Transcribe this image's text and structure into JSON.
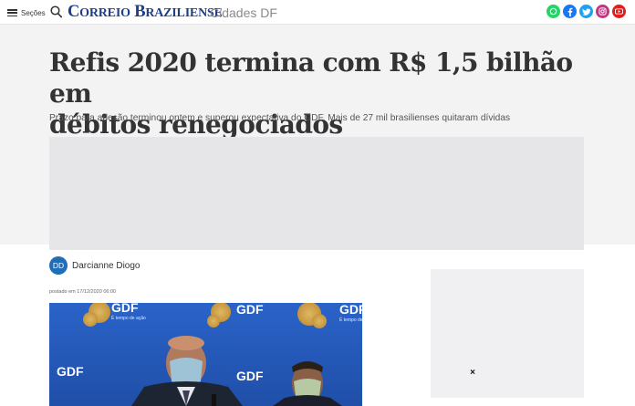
{
  "header": {
    "menu_label": "Seções",
    "logo_parts": [
      "C",
      "ORREIO",
      " B",
      "RAZILIENSE"
    ],
    "section": "Cidades DF",
    "social": [
      {
        "icon": "whatsapp-icon",
        "color": "#25d366"
      },
      {
        "icon": "facebook-icon",
        "color": "#1877f2"
      },
      {
        "icon": "twitter-icon",
        "color": "#1da1f2"
      },
      {
        "icon": "instagram-icon",
        "color": "#c13584"
      },
      {
        "icon": "youtube-icon",
        "color": "#e01e1e"
      }
    ]
  },
  "article": {
    "title_line1": "Refis 2020 termina com R$ 1,5 bilhão em",
    "title_line2": "débitos renegociados",
    "subtitle": "Prazo para adesão terminou ontem e superou expectativa do GDF. Mais de 27 mil brasilienses quitaram dívidas",
    "author_initials": "DD",
    "author_name": "Darcianne Diogo",
    "posted": "postado em 17/12/2020 06:00",
    "photo_logo_text": "GDF",
    "photo_tagline": "É tempo de ação"
  },
  "ad": {
    "close_symbol": "×"
  },
  "colors": {
    "logo_blue": "#1c3f8c",
    "avatar_blue": "#1e6fb8",
    "header_bg": "#f3f3f4"
  }
}
